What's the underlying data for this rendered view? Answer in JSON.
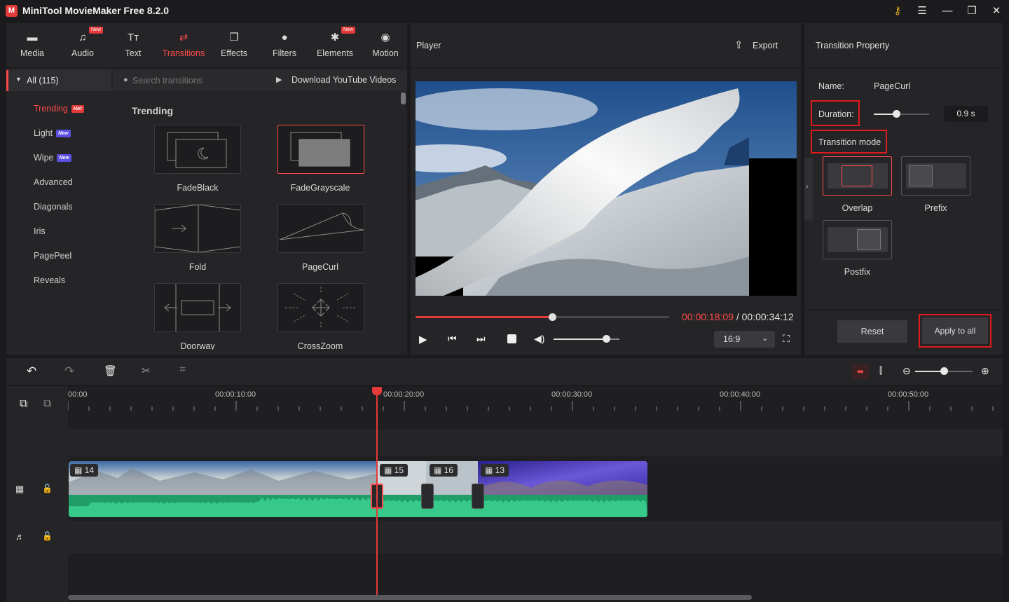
{
  "app": {
    "title": "MiniTool MovieMaker Free 8.2.0",
    "logo": "M"
  },
  "toolbar": {
    "items": [
      {
        "label": "Media",
        "icon": "media-icon",
        "glyph": "▬",
        "new": false
      },
      {
        "label": "Audio",
        "icon": "music-note-icon",
        "glyph": "♫",
        "new": true
      },
      {
        "label": "Text",
        "icon": "text-icon",
        "glyph": "Tт",
        "new": false
      },
      {
        "label": "Transitions",
        "icon": "transitions-icon",
        "glyph": "⇄",
        "new": false,
        "active": true
      },
      {
        "label": "Effects",
        "icon": "effects-icon",
        "glyph": "❐",
        "new": false
      },
      {
        "label": "Filters",
        "icon": "filters-icon",
        "glyph": "●",
        "new": false
      },
      {
        "label": "Elements",
        "icon": "elements-icon",
        "glyph": "✱",
        "new": true
      },
      {
        "label": "Motion",
        "icon": "motion-icon",
        "glyph": "◉",
        "new": false
      }
    ],
    "new_badge": "New"
  },
  "categories": {
    "all": "All (115)",
    "items": [
      {
        "label": "Trending",
        "badge": "Hot"
      },
      {
        "label": "Light",
        "badge": "New"
      },
      {
        "label": "Wipe",
        "badge": "New"
      },
      {
        "label": "Advanced",
        "badge": ""
      },
      {
        "label": "Diagonals",
        "badge": ""
      },
      {
        "label": "Iris",
        "badge": ""
      },
      {
        "label": "PagePeel",
        "badge": ""
      },
      {
        "label": "Reveals",
        "badge": ""
      }
    ]
  },
  "browser": {
    "search_placeholder": "Search transitions",
    "download_label": "Download YouTube Videos",
    "section_title": "Trending",
    "transitions": [
      "FadeBlack",
      "FadeGrayscale",
      "Fold",
      "PageCurl",
      "Doorway",
      "CrossZoom"
    ]
  },
  "player": {
    "title": "Player",
    "export_label": "Export",
    "current_time": "00:00:18:09",
    "separator": " / ",
    "total_time": "00:00:34:12",
    "aspect_ratio": "16:9",
    "progress": 0.538,
    "volume": 0.8
  },
  "property": {
    "title": "Transition Property",
    "name_label": "Name:",
    "name_value": "PageCurl",
    "duration_label": "Duration:",
    "duration_value": "0.9 s",
    "duration_level": 0.4,
    "mode_label": "Transition mode",
    "modes": [
      "Overlap",
      "Prefix",
      "Postfix"
    ],
    "selected_mode": "Overlap",
    "reset_label": "Reset",
    "apply_all_label": "Apply to all"
  },
  "timeline": {
    "ticks": [
      "00:00",
      "00:00:10:00",
      "00:00:20:00",
      "00:00:30:00",
      "00:00:40:00",
      "00:00:50:00"
    ],
    "clips": [
      "14",
      "15",
      "16",
      "13"
    ],
    "zoom_level": 0.5
  },
  "colors": {
    "accent": "#ff4a4a",
    "panel": "#252528",
    "background": "#1b1b1d",
    "audio_wave": "#2bb77f"
  }
}
